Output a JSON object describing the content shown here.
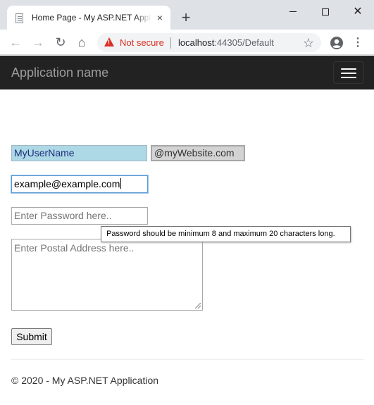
{
  "browser": {
    "tab_title": "Home Page - My ASP.NET Application",
    "tab_close": "×",
    "new_tab": "+",
    "window_controls": {
      "close": "✕"
    },
    "toolbar": {
      "back": "←",
      "forward": "→",
      "reload": "↻",
      "home": "⌂",
      "security_label": "Not secure",
      "url_host": "localhost",
      "url_rest": ":44305/Default",
      "bookmark_star": "☆",
      "menu": "⋮"
    }
  },
  "navbar": {
    "brand": "Application name"
  },
  "form": {
    "username_value": "MyUserName",
    "domain_suffix": "@myWebsite.com",
    "email_value": "example@example.com",
    "password_placeholder": "Enter Password here..",
    "password_tooltip": "Password should be minimum 8 and maximum 20 characters long.",
    "address_placeholder": "Enter Postal Address here..",
    "submit_label": "Submit"
  },
  "footer": {
    "text": "© 2020 - My ASP.NET Application"
  },
  "colors": {
    "navbar_bg": "#222222",
    "brand_text": "#9d9d9d",
    "username_bg": "#add8e6",
    "domain_bg": "#d3d3d3",
    "warning_red": "#d93025"
  }
}
